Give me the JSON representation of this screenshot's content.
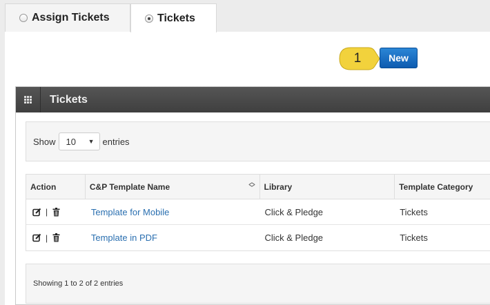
{
  "tabs": [
    {
      "label": "Assign Tickets",
      "active": false
    },
    {
      "label": "Tickets",
      "active": true
    }
  ],
  "callout": {
    "number": "1",
    "color": "#f2d23c"
  },
  "toolbar": {
    "new_label": "New"
  },
  "widget": {
    "title": "Tickets",
    "header_icon": "grid-icon"
  },
  "length": {
    "show_label": "Show",
    "selected": "10",
    "entries_label": "entries"
  },
  "table": {
    "headers": [
      "Action",
      "C&P Template Name",
      "Library",
      "Template Category"
    ],
    "rows": [
      {
        "name": "Template for Mobile",
        "library": "Click & Pledge",
        "category": "Tickets",
        "separator": "|"
      },
      {
        "name": "Template in PDF",
        "library": "Click & Pledge",
        "category": "Tickets",
        "separator": "|"
      }
    ]
  },
  "info": {
    "text": "Showing 1 to 2 of 2 entries"
  },
  "colors": {
    "accent": "#1a6fc7",
    "header_bg": "#474747",
    "link": "#2a6fb0"
  }
}
